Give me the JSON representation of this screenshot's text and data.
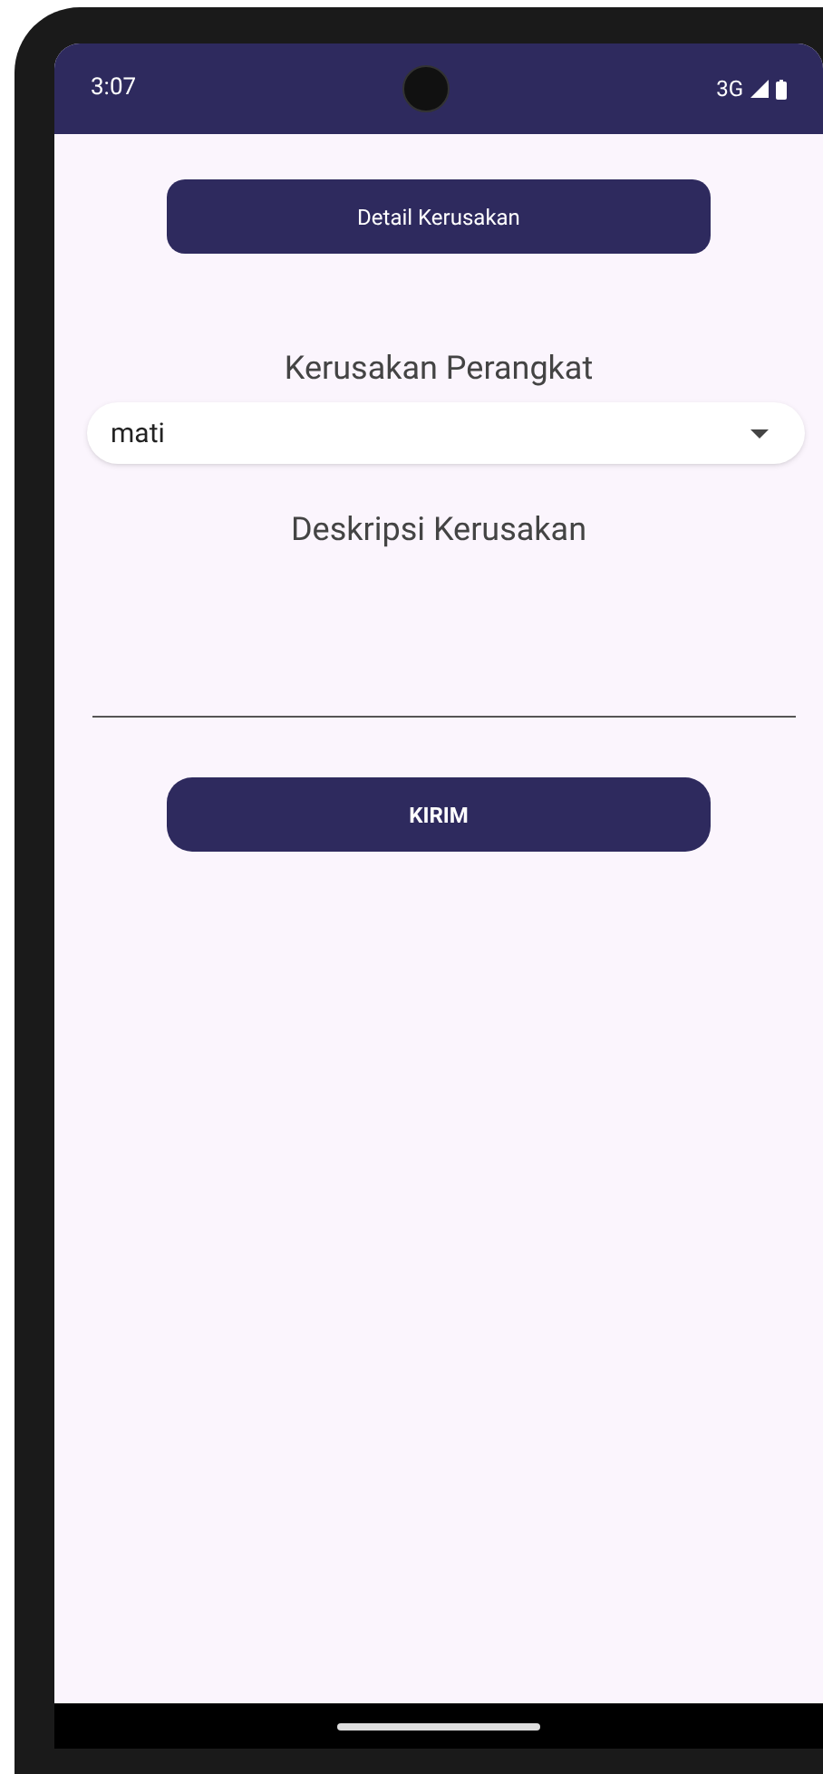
{
  "status_bar": {
    "time": "3:07",
    "network": "3G"
  },
  "header_button": "Detail Kerusakan",
  "device_damage": {
    "label": "Kerusakan Perangkat",
    "value": "mati"
  },
  "description": {
    "label": "Deskripsi Kerusakan"
  },
  "submit_button": "KIRIM"
}
